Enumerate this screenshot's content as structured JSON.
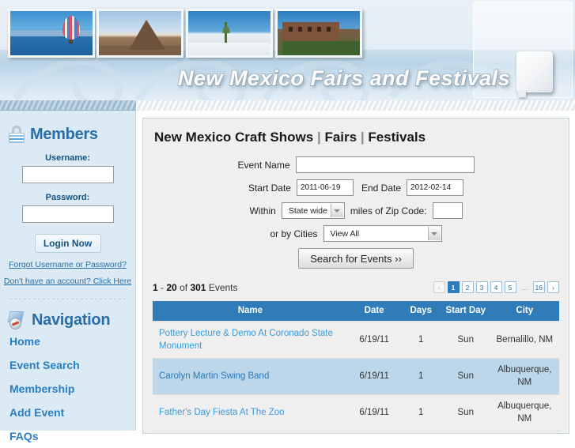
{
  "header": {
    "title": "New Mexico Fairs and Festivals",
    "photos": [
      {
        "name": "hot-air-balloon-photo"
      },
      {
        "name": "rock-formation-photo"
      },
      {
        "name": "white-sands-yucca-photo"
      },
      {
        "name": "adobe-building-photo"
      }
    ],
    "state_shape_name": "new-mexico-state-shape"
  },
  "sidebar": {
    "members": {
      "heading": "Members",
      "icon": "lock-icon",
      "username_label": "Username:",
      "username_value": "",
      "password_label": "Password:",
      "password_value": "",
      "login_button": "Login Now",
      "links": [
        "Forgot Username or Password?",
        "Don't have an account? Click Here"
      ]
    },
    "navigation": {
      "heading": "Navigation",
      "icon": "compass-map-icon",
      "items": [
        "Home",
        "Event Search",
        "Membership",
        "Add Event",
        "FAQs"
      ]
    }
  },
  "main": {
    "title_part1": "New Mexico Craft Shows",
    "title_sep1": "|",
    "title_part2": "Fairs",
    "title_sep2": "|",
    "title_part3": "Festivals",
    "form": {
      "event_name_label": "Event Name",
      "event_name_value": "",
      "start_date_label": "Start Date",
      "start_date_value": "2011-06-19",
      "end_date_label": "End Date",
      "end_date_value": "2012-02-14",
      "within_label": "Within",
      "within_value": "State wide",
      "miles_label": "miles of Zip Code:",
      "zip_value": "",
      "cities_label": "or by Cities",
      "cities_value": "View All",
      "search_button": "Search for Events ››"
    },
    "results": {
      "range_start": "1",
      "range_dash": "-",
      "range_end": "20",
      "of_word": "of",
      "total": "301",
      "events_word": "Events",
      "pager": [
        "‹",
        "1",
        "2",
        "3",
        "4",
        "5",
        "…",
        "16",
        "›"
      ],
      "current_page": "1"
    },
    "table": {
      "columns": [
        "Name",
        "Date",
        "Days",
        "Start Day",
        "City"
      ],
      "rows": [
        {
          "name": "Pottery Lecture & Demo At Coronado State Monument",
          "date": "6/19/11",
          "days": "1",
          "start_day": "Sun",
          "city": "Bernalillo, NM"
        },
        {
          "name": "Carolyn Martin Swing Band",
          "date": "6/19/11",
          "days": "1",
          "start_day": "Sun",
          "city": "Albuquerque, NM"
        },
        {
          "name": "Father's Day Fiesta At The Zoo",
          "date": "6/19/11",
          "days": "1",
          "start_day": "Sun",
          "city": "Albuquerque, NM"
        }
      ]
    }
  },
  "colors": {
    "accent_blue": "#2f7cb8",
    "link_blue": "#3b9ada",
    "sidebar_bg": "#dceaf5",
    "row_alt": "#bcd7ea"
  }
}
